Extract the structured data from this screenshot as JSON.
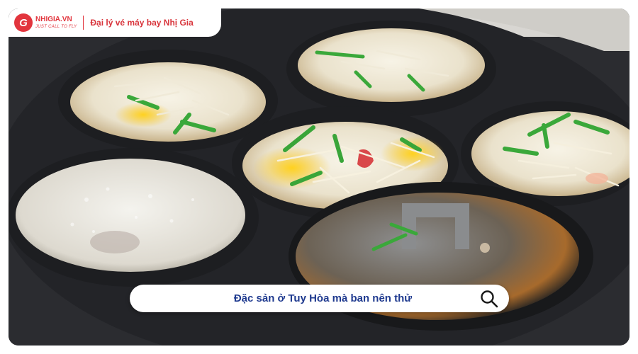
{
  "brand": {
    "logo_name": "NHIGIA.VN",
    "logo_tagline": "JUST CALL TO FLY",
    "logo_glyph": "G",
    "title": "Đại lý vé máy bay Nhị Gia",
    "accent_color": "#e2353d"
  },
  "search": {
    "text": "Đặc sản ở Tuy Hòa mà ban nên thử",
    "text_color": "#1f3a8f",
    "icon": "search-icon"
  },
  "photo": {
    "subject_icon": "banh-can-pancake-molds"
  }
}
